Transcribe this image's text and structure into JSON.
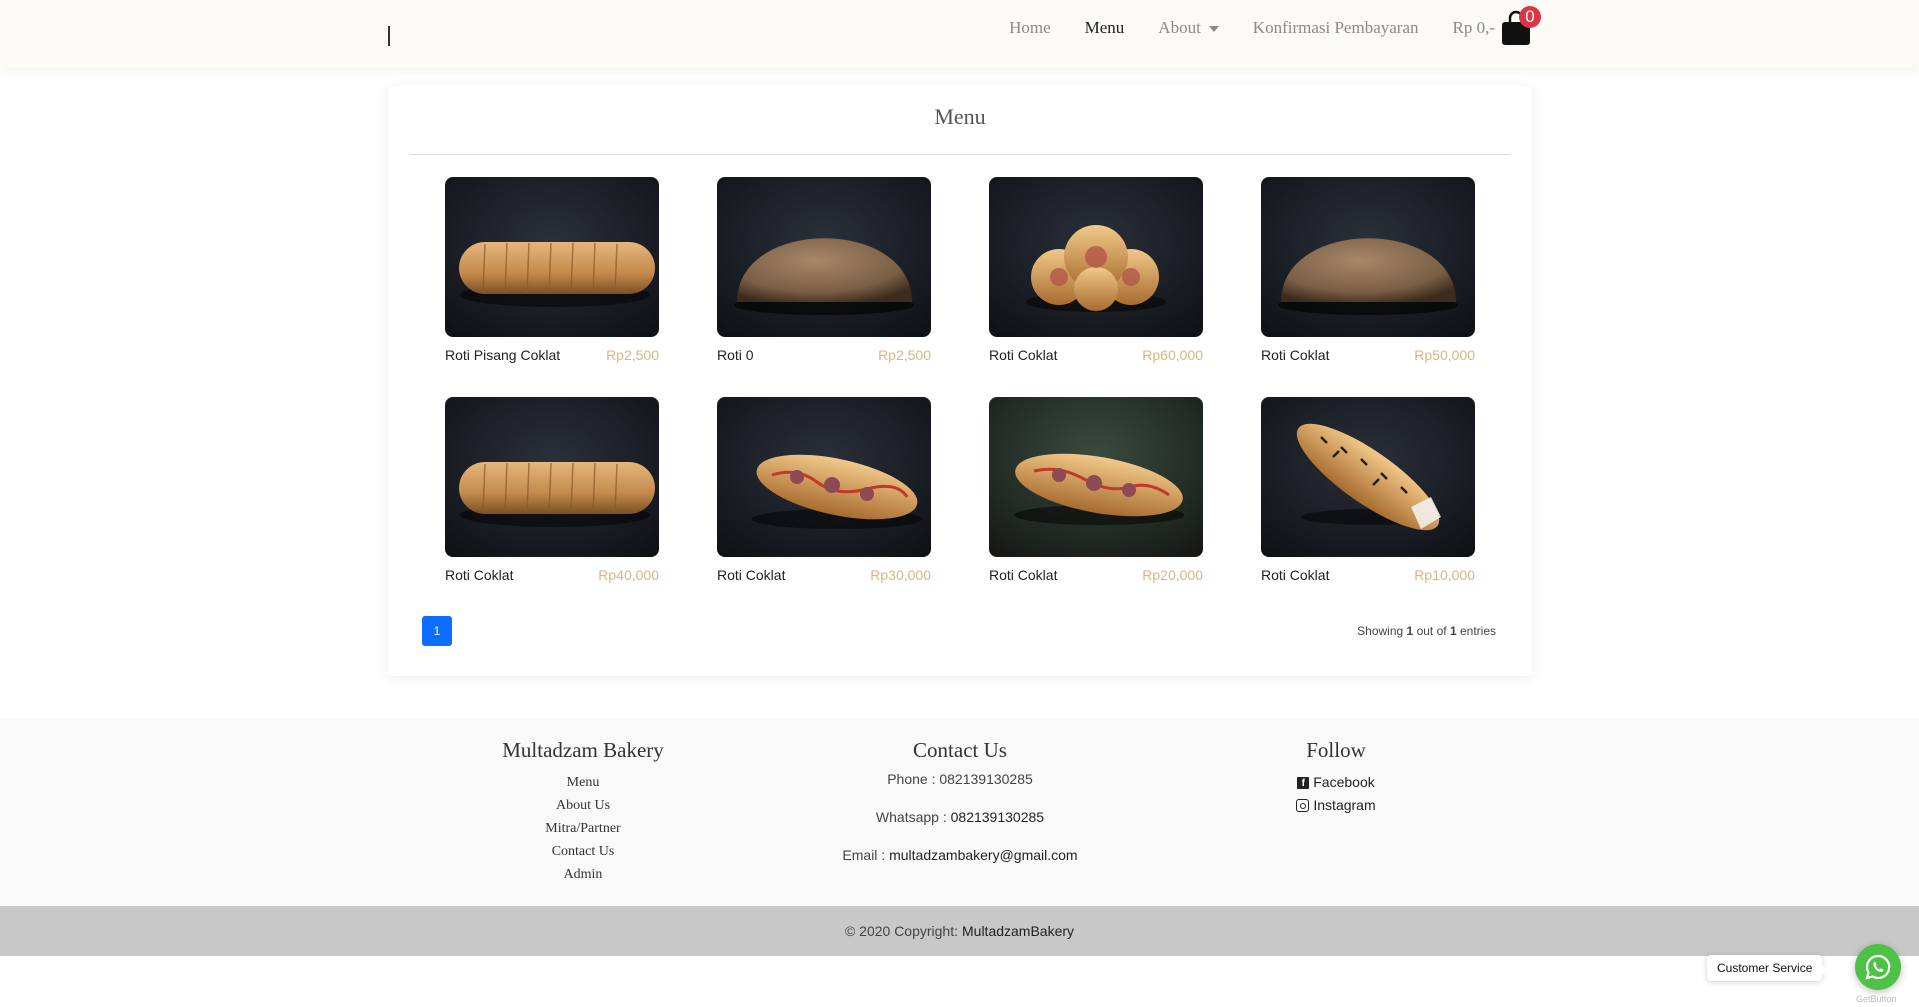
{
  "nav": {
    "links": [
      "Home",
      "Menu",
      "About",
      "Konfirmasi Pembayaran"
    ],
    "cart_total": "Rp 0,-",
    "cart_count": "0",
    "cart_icon": "shopping-bag-icon",
    "dropdown_icon": "caret-down-icon"
  },
  "menu": {
    "title": "Menu",
    "products": [
      {
        "name": "Roti Pisang Coklat",
        "price": "Rp2,500"
      },
      {
        "name": "Roti 0",
        "price": "Rp2,500"
      },
      {
        "name": "Roti Coklat",
        "price": "Rp60,000"
      },
      {
        "name": "Roti Coklat",
        "price": "Rp50,000"
      },
      {
        "name": "Roti Coklat",
        "price": "Rp40,000"
      },
      {
        "name": "Roti Coklat",
        "price": "Rp30,000"
      },
      {
        "name": "Roti Coklat",
        "price": "Rp20,000"
      },
      {
        "name": "Roti Coklat",
        "price": "Rp10,000"
      }
    ],
    "pagination": {
      "current": "1"
    },
    "showing": {
      "prefix": "Showing",
      "shown": "1",
      "middle": "out of",
      "total": "1",
      "suffix": "entries"
    }
  },
  "footer": {
    "col1": {
      "title": "Multadzam Bakery",
      "links": [
        "Menu",
        "About Us",
        "Mitra/Partner",
        "Contact Us",
        "Admin"
      ]
    },
    "col2": {
      "title": "Contact Us",
      "phone_label": "Phone : ",
      "phone": "082139130285",
      "whatsapp_label": "Whatsapp : ",
      "whatsapp": "082139130285",
      "email_label": "Email : ",
      "email": "multadzambakery@gmail.com"
    },
    "col3": {
      "title": "Follow",
      "links": [
        "Facebook",
        "Instagram"
      ]
    },
    "copyright_prefix": "© 2020 Copyright:",
    "copyright_brand": "MultadzamBakery"
  },
  "widget": {
    "label": "Customer Service",
    "powered": "GetButton",
    "icon": "whatsapp-icon"
  },
  "colors": {
    "navbar_bg": "#fcfaf4",
    "price": "#dcb57c",
    "page_active": "#0d6efd",
    "badge": "#dc3545",
    "whatsapp": "#4dc247",
    "copyright_bg": "#c8c8c8"
  }
}
